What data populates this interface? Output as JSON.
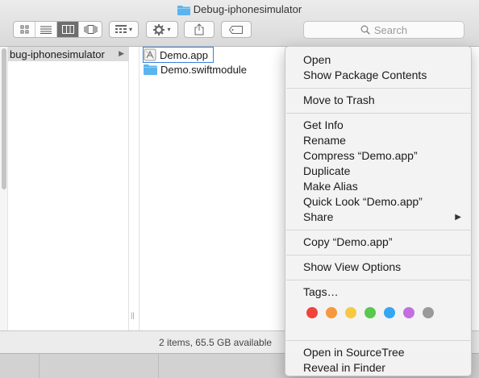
{
  "window": {
    "title": "Debug-iphonesimulator"
  },
  "toolbar": {
    "view_buttons": [
      "icon-view",
      "list-view",
      "column-view",
      "cover-flow-view"
    ],
    "search_placeholder": "Search"
  },
  "sidebar_column": {
    "selected_item": "bug-iphonesimulator"
  },
  "files": [
    {
      "name": "Demo.app",
      "icon": "app-icon",
      "selected": true
    },
    {
      "name": "Demo.swiftmodule",
      "icon": "folder-icon",
      "selected": false
    }
  ],
  "status": {
    "text": "2 items, 65.5 GB available"
  },
  "context_menu": {
    "open": "Open",
    "show_package_contents": "Show Package Contents",
    "move_to_trash": "Move to Trash",
    "get_info": "Get Info",
    "rename": "Rename",
    "compress": "Compress “Demo.app”",
    "duplicate": "Duplicate",
    "make_alias": "Make Alias",
    "quick_look": "Quick Look “Demo.app”",
    "share": "Share",
    "copy": "Copy “Demo.app”",
    "show_view_options": "Show View Options",
    "tags": "Tags…",
    "tag_colors": [
      "#f0433a",
      "#f6983e",
      "#f7c842",
      "#5ac74f",
      "#35a7f2",
      "#c36ee0",
      "#9a9a9a"
    ],
    "open_in_sourcetree": "Open in SourceTree",
    "reveal_in_finder": "Reveal in Finder"
  },
  "colors": {
    "selection_outline": "#3d7ee0",
    "folder": "#5bb4ee"
  }
}
